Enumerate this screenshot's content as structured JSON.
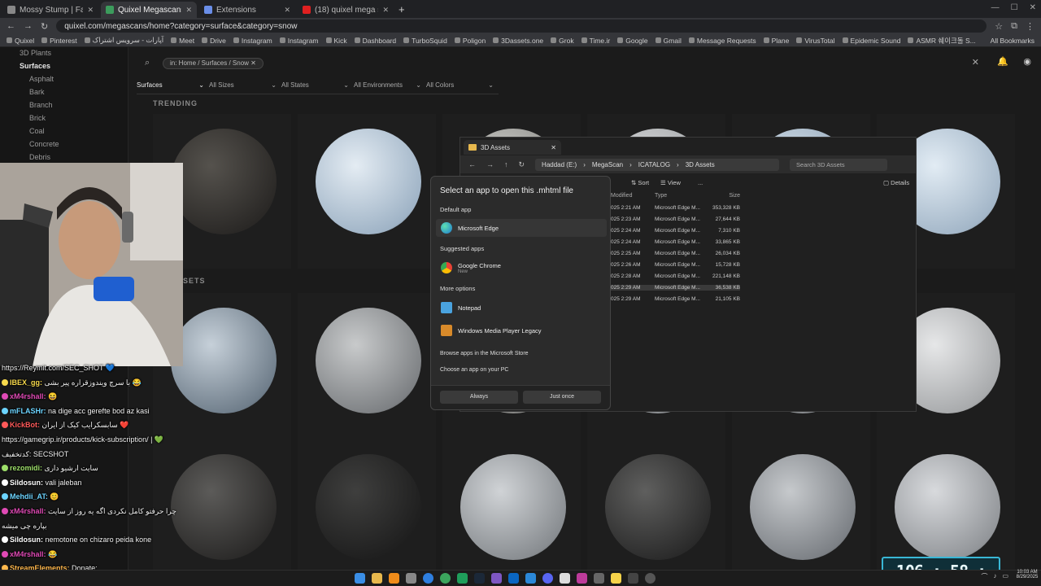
{
  "browser": {
    "tabs": [
      {
        "label": "Mossy Stump | Fab",
        "active": false
      },
      {
        "label": "Quixel Megascans",
        "active": true
      },
      {
        "label": "Extensions",
        "active": false
      },
      {
        "label": "(18) quixel mega scan csgo ma",
        "active": false
      }
    ],
    "new_tab": "+",
    "url": "quixel.com/megascans/home?category=surface&category=snow",
    "bookmarks": [
      "Quixel",
      "Pinterest",
      "آپارات - سرویس اشتراک",
      "Meet",
      "Drive",
      "Instagram",
      "Instagram",
      "Kick",
      "Dashboard",
      "TurboSquid",
      "Poligon",
      "3Dassets.one",
      "Grok",
      "Time.ir",
      "Google",
      "Gmail",
      "Message Requests",
      "Plane",
      "VirusTotal",
      "Epidemic Sound",
      "ASMR 쉐이크돌 S..."
    ],
    "all_bookmarks": "All Bookmarks"
  },
  "sidebar": {
    "items": [
      {
        "label": "3D Plants",
        "level": "top"
      },
      {
        "label": "Surfaces",
        "level": "active"
      },
      {
        "label": "Asphalt",
        "level": "sub"
      },
      {
        "label": "Bark",
        "level": "sub"
      },
      {
        "label": "Branch",
        "level": "sub"
      },
      {
        "label": "Brick",
        "level": "sub"
      },
      {
        "label": "Coal",
        "level": "sub"
      },
      {
        "label": "Concrete",
        "level": "sub"
      },
      {
        "label": "Debris",
        "level": "sub"
      }
    ]
  },
  "search": {
    "chip": "in: Home / Surfaces / Snow"
  },
  "filters": [
    "Surfaces",
    "All Sizes",
    "All States",
    "All Environments",
    "All Colors"
  ],
  "sections": {
    "trending": "TRENDING",
    "assets_fragment": "SETS"
  },
  "explorer": {
    "tab_title": "3D Assets",
    "breadcrumbs": [
      "Haddad (E:)",
      "MegaScan",
      "ICATALOG",
      "3D Assets"
    ],
    "search_placeholder": "Search 3D Assets",
    "commands": {
      "sort": "Sort",
      "view": "View",
      "more": "...",
      "details": "Details"
    },
    "columns": {
      "modified": "Modified",
      "type": "Type",
      "size": "Size"
    },
    "rows": [
      {
        "modified": "025 2:21 AM",
        "type": "Microsoft Edge M...",
        "size": "353,328 KB"
      },
      {
        "modified": "025 2:23 AM",
        "type": "Microsoft Edge M...",
        "size": "27,644 KB"
      },
      {
        "modified": "025 2:24 AM",
        "type": "Microsoft Edge M...",
        "size": "7,310 KB"
      },
      {
        "modified": "025 2:24 AM",
        "type": "Microsoft Edge M...",
        "size": "33,865 KB"
      },
      {
        "modified": "025 2:25 AM",
        "type": "Microsoft Edge M...",
        "size": "26,034 KB"
      },
      {
        "modified": "025 2:26 AM",
        "type": "Microsoft Edge M...",
        "size": "15,728 KB"
      },
      {
        "modified": "025 2:28 AM",
        "type": "Microsoft Edge M...",
        "size": "221,148 KB"
      },
      {
        "modified": "025 2:29 AM",
        "type": "Microsoft Edge M...",
        "size": "36,538 KB"
      },
      {
        "modified": "025 2:29 AM",
        "type": "Microsoft Edge M...",
        "size": "21,105 KB"
      }
    ]
  },
  "dialog": {
    "title": "Select an app to open this .mhtml file",
    "default_label": "Default app",
    "default_app": "Microsoft Edge",
    "suggested_label": "Suggested apps",
    "suggested_app": "Google Chrome",
    "suggested_sub": "New",
    "more_label": "More options",
    "more_apps": [
      "Notepad",
      "Windows Media Player Legacy"
    ],
    "browse_store": "Browse apps in the Microsoft Store",
    "choose_pc": "Choose an app on your PC",
    "always": "Always",
    "just_once": "Just once"
  },
  "chat": [
    {
      "nick": "",
      "text": "https://Reymit.com/SEC_SHOT 💙"
    },
    {
      "nick": "IBEX_gg:",
      "text": "با سرچ ویندوزقراره پیر بشی 😂"
    },
    {
      "nick": "xM4rshall:",
      "text": "😆"
    },
    {
      "nick": "mFLASHr:",
      "text": "na dige acc gerefte bod az kasi"
    },
    {
      "nick": "KickBot:",
      "text": "سابسکرایب کیک از ایران ❤️"
    },
    {
      "nick": "",
      "text": "https://gamegrip.ir/products/kick-subscription/ | 💚"
    },
    {
      "nick": "",
      "text": "کدتخفیف: SECSHOT"
    },
    {
      "nick": "rezomidi:",
      "text": "سایت ارشیو داری"
    },
    {
      "nick": "Sildosun:",
      "text": "vali jaleban"
    },
    {
      "nick": "Mehdii_AT:",
      "text": "😊"
    },
    {
      "nick": "xM4rshall:",
      "text": "چرا حرفتو کامل نکردی اگه یه روز از سایت"
    },
    {
      "nick": "",
      "text": "بپاره چی میشه"
    },
    {
      "nick": "Sildosun:",
      "text": "nemotone on chizaro peida kone"
    },
    {
      "nick": "xM4rshall:",
      "text": "😂"
    },
    {
      "nick": "StreamElements:",
      "text": "Donate:"
    },
    {
      "nick": "",
      "text": "https://Reymit.com/SEC_SHOT 💙"
    }
  ],
  "timer": "106 : 58 : 03",
  "clock": {
    "time": "10:03 AM",
    "date": "8/29/2025"
  },
  "colors": {
    "accent": "#39b7d6",
    "folder": "#e7b84d"
  }
}
